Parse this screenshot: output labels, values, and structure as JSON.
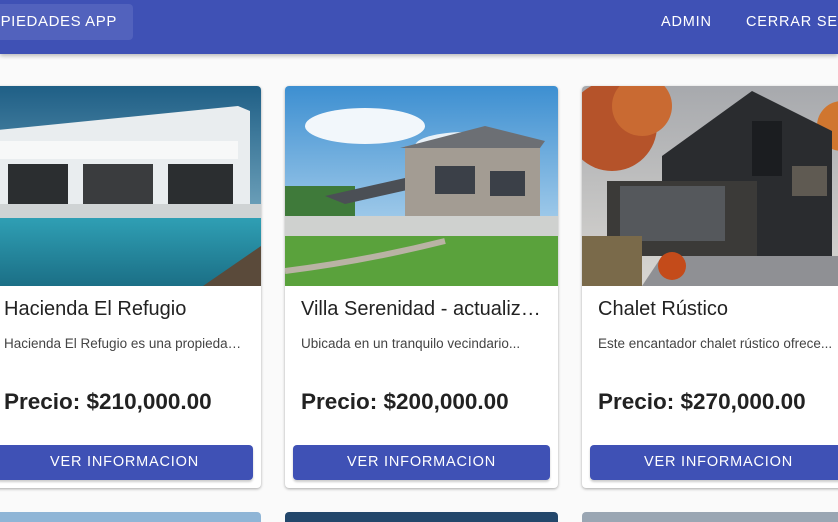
{
  "appbar": {
    "brand": "PIEDADES APP",
    "nav": {
      "admin": "ADMIN",
      "logout": "CERRAR SE"
    }
  },
  "properties": [
    {
      "title": "Hacienda El Refugio",
      "description": "Hacienda El Refugio es una propiedad...",
      "price": "Precio: $210,000.00",
      "button": "VER INFORMACION"
    },
    {
      "title": "Villa Serenidad - actualizada",
      "description": "Ubicada en un tranquilo vecindario...",
      "price": "Precio: $200,000.00",
      "button": "VER INFORMACION"
    },
    {
      "title": "Chalet Rústico",
      "description": "Este encantador chalet rústico ofrece...",
      "price": "Precio: $270,000.00",
      "button": "VER INFORMACION"
    }
  ],
  "colors": {
    "primary": "#3f51b5",
    "background": "#fafafa"
  }
}
